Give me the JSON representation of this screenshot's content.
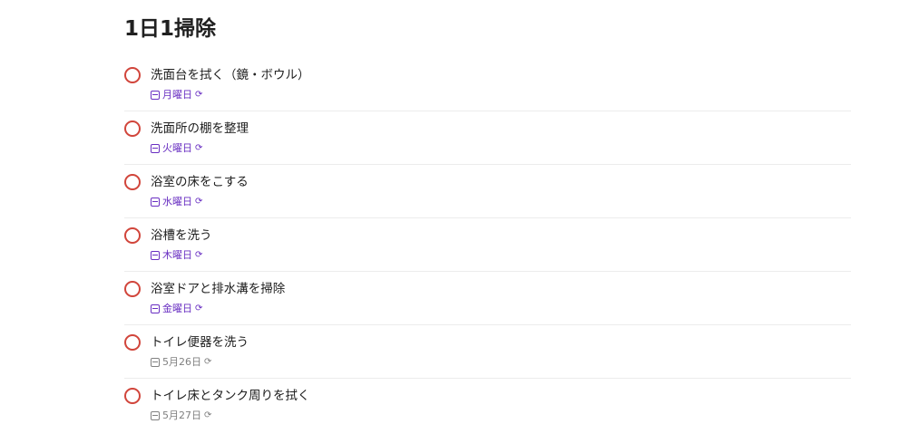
{
  "project": {
    "title": "1日1掃除"
  },
  "tasks": [
    {
      "name": "洗面台を拭く（鏡・ボウル）",
      "date": "月曜日",
      "recurring": true,
      "date_color": "#692fc2"
    },
    {
      "name": "洗面所の棚を整理",
      "date": "火曜日",
      "recurring": true,
      "date_color": "#692fc2"
    },
    {
      "name": "浴室の床をこする",
      "date": "水曜日",
      "recurring": true,
      "date_color": "#692fc2"
    },
    {
      "name": "浴槽を洗う",
      "date": "木曜日",
      "recurring": true,
      "date_color": "#692fc2"
    },
    {
      "name": "浴室ドアと排水溝を掃除",
      "date": "金曜日",
      "recurring": true,
      "date_color": "#692fc2"
    },
    {
      "name": "トイレ便器を洗う",
      "date": "5月26日",
      "recurring": true,
      "date_color": "#808080"
    },
    {
      "name": "トイレ床とタンク周りを拭く",
      "date": "5月27日",
      "recurring": true,
      "date_color": "#808080"
    }
  ],
  "colors": {
    "checkbox_border": "#d1453b",
    "weekday_date": "#692fc2",
    "calendar_date": "#808080",
    "divider": "#ececec"
  },
  "icons": {
    "calendar": "calendar-icon",
    "recurring": "recurring-icon"
  }
}
